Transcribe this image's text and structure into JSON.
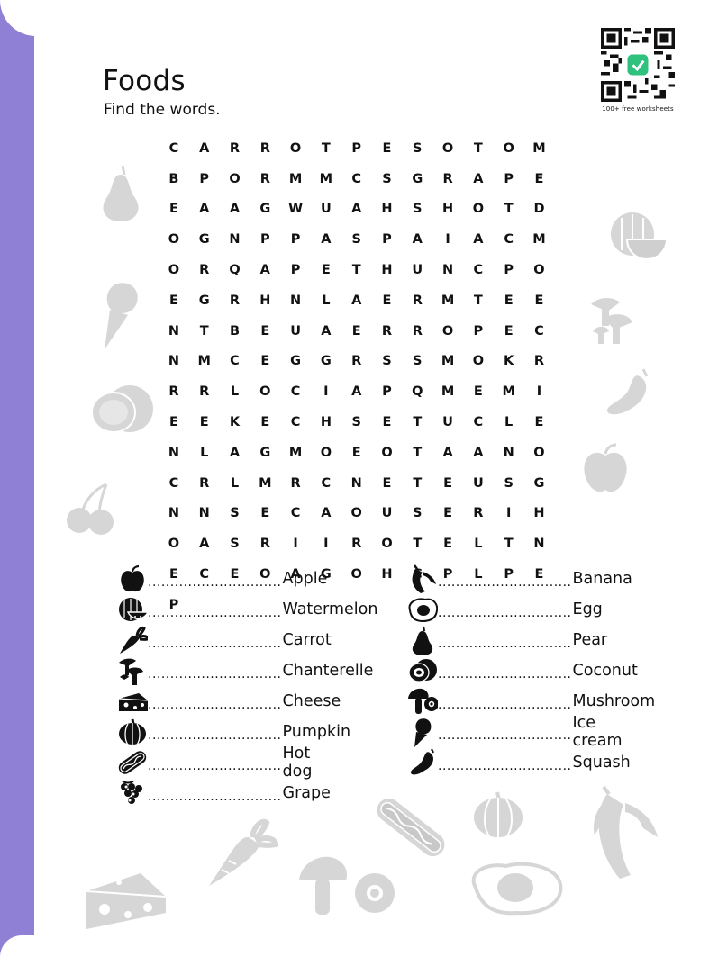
{
  "sheet": {
    "title": "Foods",
    "subtitle": "Find the words.",
    "qr_caption": "100+ free worksheets",
    "accent_color": "#8f7fd5",
    "decor_color": "#d6d6d6"
  },
  "grid": [
    [
      "C",
      "A",
      "R",
      "R",
      "O",
      "T",
      "P",
      "E",
      "S",
      "O",
      "T",
      "O",
      "M",
      "B"
    ],
    [
      "P",
      "O",
      "R",
      "M",
      "M",
      "C",
      "S",
      "G",
      "R",
      "A",
      "P",
      "E",
      "E",
      "A"
    ],
    [
      "A",
      "G",
      "W",
      "U",
      "A",
      "H",
      "S",
      "H",
      "O",
      "T",
      "D",
      "O",
      "G",
      "N"
    ],
    [
      "P",
      "P",
      "A",
      "S",
      "P",
      "A",
      "I",
      "A",
      "C",
      "M",
      "O",
      "R",
      "Q",
      "A"
    ],
    [
      "P",
      "E",
      "T",
      "H",
      "U",
      "N",
      "C",
      "P",
      "O",
      "E",
      "G",
      "R",
      "H",
      "N"
    ],
    [
      "L",
      "A",
      "E",
      "R",
      "M",
      "T",
      "E",
      "E",
      "N",
      "T",
      "B",
      "E",
      "U",
      "A"
    ],
    [
      "E",
      "R",
      "R",
      "O",
      "P",
      "E",
      "C",
      "N",
      "M",
      "C",
      "E",
      "G",
      "G",
      "R"
    ],
    [
      "S",
      "S",
      "M",
      "O",
      "K",
      "R",
      "R",
      "R",
      "L",
      "O",
      "C",
      "I",
      "A",
      "P"
    ],
    [
      "Q",
      "M",
      "E",
      "M",
      "I",
      "E",
      "E",
      "K",
      "E",
      "C",
      "H",
      "S",
      "E",
      "T"
    ],
    [
      "U",
      "C",
      "L",
      "E",
      "N",
      "L",
      "A",
      "G",
      "M",
      "O",
      "E",
      "O",
      "T",
      "A"
    ],
    [
      "A",
      "N",
      "O",
      "C",
      "R",
      "L",
      "M",
      "R",
      "C",
      "N",
      "E",
      "T",
      "E",
      "U"
    ],
    [
      "S",
      "G",
      "N",
      "N",
      "S",
      "E",
      "C",
      "A",
      "O",
      "U",
      "S",
      "E",
      "R",
      "I"
    ],
    [
      "H",
      "O",
      "A",
      "S",
      "R",
      "I",
      "I",
      "R",
      "O",
      "T",
      "E",
      "L",
      "T",
      "N"
    ],
    [
      "E",
      "C",
      "E",
      "O",
      "A",
      "G",
      "O",
      "H",
      "C",
      "P",
      "L",
      "P",
      "E",
      "P"
    ]
  ],
  "word_list": {
    "leader": "..............................",
    "left": [
      {
        "word": "Apple",
        "icon": "apple-icon"
      },
      {
        "word": "Watermelon",
        "icon": "watermelon-icon"
      },
      {
        "word": "Carrot",
        "icon": "carrot-icon"
      },
      {
        "word": "Chanterelle",
        "icon": "chanterelle-icon"
      },
      {
        "word": "Cheese",
        "icon": "cheese-icon"
      },
      {
        "word": "Pumpkin",
        "icon": "pumpkin-icon"
      },
      {
        "word": "Hot dog",
        "icon": "hotdog-icon"
      },
      {
        "word": "Grape",
        "icon": "grape-icon"
      }
    ],
    "right": [
      {
        "word": "Banana",
        "icon": "banana-icon"
      },
      {
        "word": "Egg",
        "icon": "egg-icon"
      },
      {
        "word": "Pear",
        "icon": "pear-icon"
      },
      {
        "word": "Coconut",
        "icon": "coconut-icon"
      },
      {
        "word": "Mushroom",
        "icon": "mushroom-icon"
      },
      {
        "word": "Ice cream",
        "icon": "ice-cream-icon"
      },
      {
        "word": "Squash",
        "icon": "squash-icon"
      }
    ]
  }
}
